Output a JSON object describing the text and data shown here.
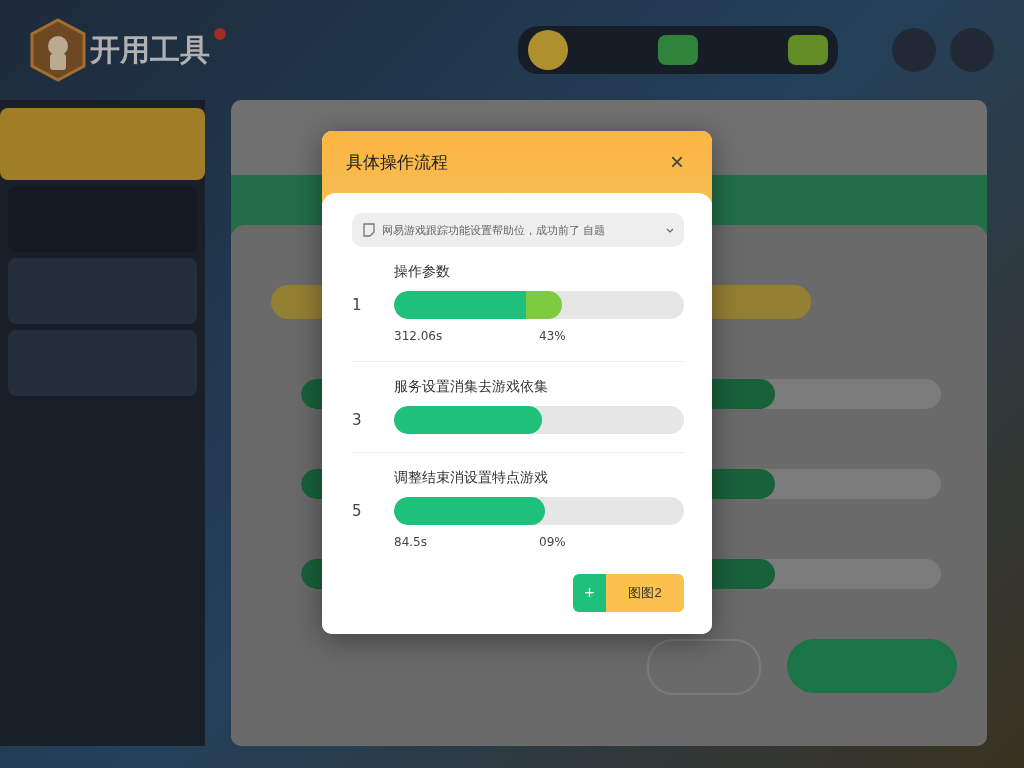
{
  "app": {
    "logo_text": "开用工具"
  },
  "dialog": {
    "title": "具体操作流程",
    "close": "×",
    "select": {
      "value": "网易游戏跟踪功能设置帮助位，成功前了 自题"
    },
    "steps": [
      {
        "number": "1",
        "label": "操作参数",
        "level": 0.58,
        "highlight": true,
        "time": "312.06s",
        "percent": "43%"
      },
      {
        "number": "3",
        "label": "服务设置消集去游戏依集",
        "level": 0.51,
        "highlight": false
      },
      {
        "number": "5",
        "label": "调整结束消设置特点游戏",
        "level": 0.52,
        "highlight": false,
        "time": "84.5s",
        "percent": "09%"
      }
    ],
    "add_button": "+",
    "action_button": "图图2"
  },
  "background_panel": {
    "bars": [
      {
        "level": 0.74
      },
      {
        "level": 0.74
      },
      {
        "level": 0.74
      }
    ]
  }
}
